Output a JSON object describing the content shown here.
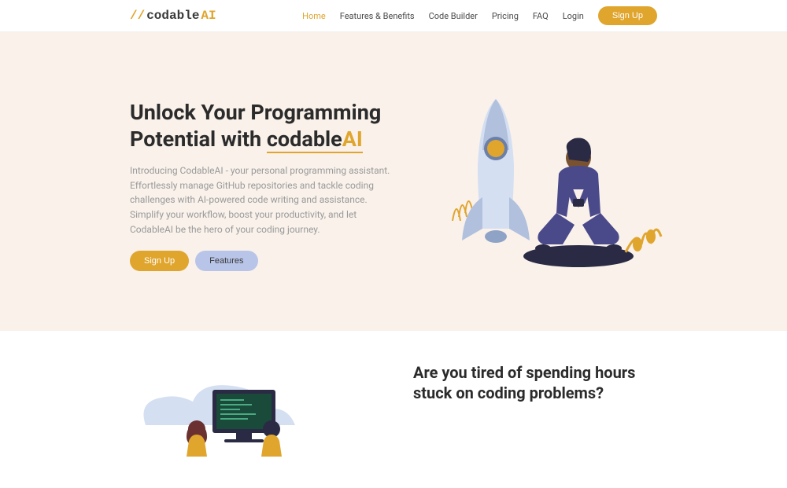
{
  "brand": {
    "slash": "//",
    "name": "codable",
    "suffix": "AI"
  },
  "nav": {
    "items": [
      {
        "label": "Home",
        "active": true
      },
      {
        "label": "Features & Benefits",
        "active": false
      },
      {
        "label": "Code Builder",
        "active": false
      },
      {
        "label": "Pricing",
        "active": false
      },
      {
        "label": "FAQ",
        "active": false
      },
      {
        "label": "Login",
        "active": false
      }
    ],
    "signup": "Sign Up"
  },
  "hero": {
    "title_pre": "Unlock Your Programming Potential with ",
    "title_brand": "codable",
    "title_ai": "AI",
    "description": "Introducing CodableAI - your personal programming assistant. Effortlessly manage GitHub repositories and tackle coding challenges with AI-powered code writing and assistance. Simplify your workflow, boost your productivity, and let CodableAI be the hero of your coding journey.",
    "cta_primary": "Sign Up",
    "cta_secondary": "Features"
  },
  "section2": {
    "title": "Are you tired of spending hours stuck on coding problems?"
  },
  "colors": {
    "accent": "#e0a52d",
    "hero_bg": "#f9f1ea",
    "secondary_btn": "#b8c5e8"
  }
}
